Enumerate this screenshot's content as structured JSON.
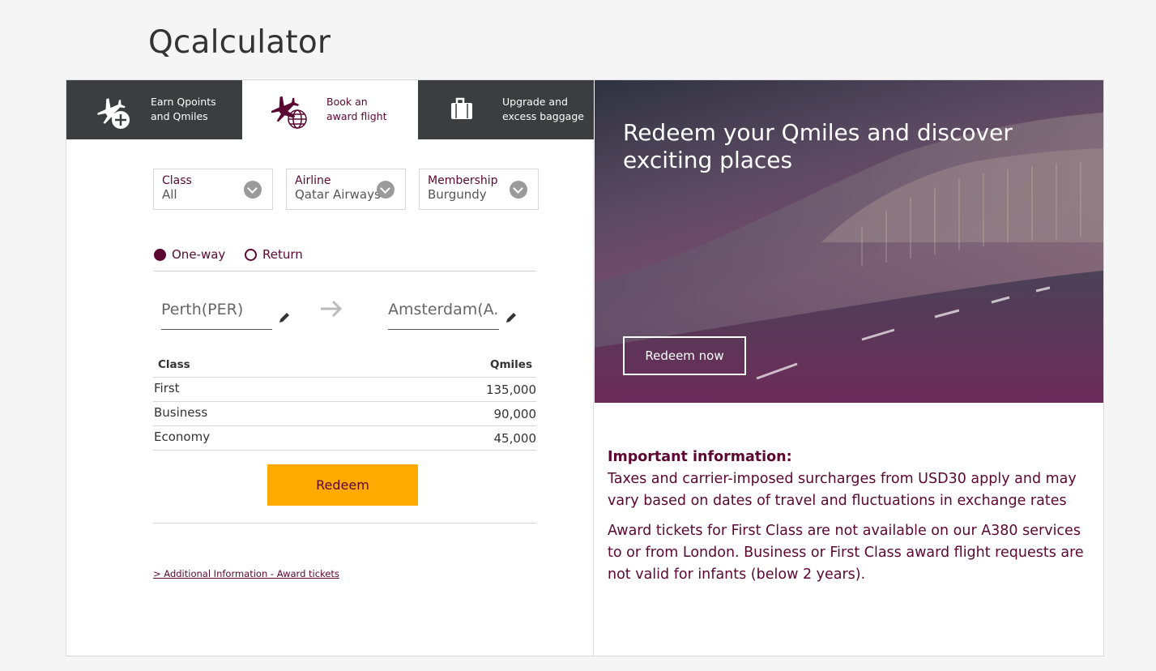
{
  "page": {
    "title": "Qcalculator"
  },
  "tabs": [
    {
      "line1": "Earn Qpoints",
      "line2": "and Qmiles",
      "icon": "plane-plus-icon",
      "active": false
    },
    {
      "line1": "Book an",
      "line2": "award flight",
      "icon": "plane-globe-icon",
      "active": true
    },
    {
      "line1": "Upgrade and",
      "line2": "excess baggage",
      "icon": "suitcase-icon",
      "active": false
    }
  ],
  "filters": {
    "class": {
      "label": "Class",
      "value": "All"
    },
    "airline": {
      "label": "Airline",
      "value": "Qatar Airways"
    },
    "membership": {
      "label": "Membership",
      "value": "Burgundy"
    }
  },
  "trip_type": {
    "one_way": "One-way",
    "return": "Return",
    "selected": "one_way"
  },
  "route": {
    "origin": "Perth(PER)",
    "destination": "Amsterdam(A..."
  },
  "table": {
    "headers": {
      "class": "Class",
      "qmiles": "Qmiles"
    },
    "rows": [
      {
        "class": "First",
        "qmiles": "135,000"
      },
      {
        "class": "Business",
        "qmiles": "90,000"
      },
      {
        "class": "Economy",
        "qmiles": "45,000"
      }
    ]
  },
  "redeem_button": "Redeem",
  "additional_link": "> Additional Information - Award tickets",
  "hero": {
    "title": "Redeem your Qmiles and discover exciting places",
    "button": "Redeem now"
  },
  "info": {
    "heading": "Important information:",
    "para1": "Taxes and carrier-imposed surcharges from USD30 apply and may vary based on dates of travel and fluctuations in exchange rates",
    "para2": "Award tickets for First Class are not available on our A380 services to or from London. Business or First Class award flight requests are not valid for infants (below 2 years)."
  },
  "colors": {
    "brand": "#5c0632",
    "accent": "#ffaa00",
    "tab_dark": "#3b3d40"
  }
}
